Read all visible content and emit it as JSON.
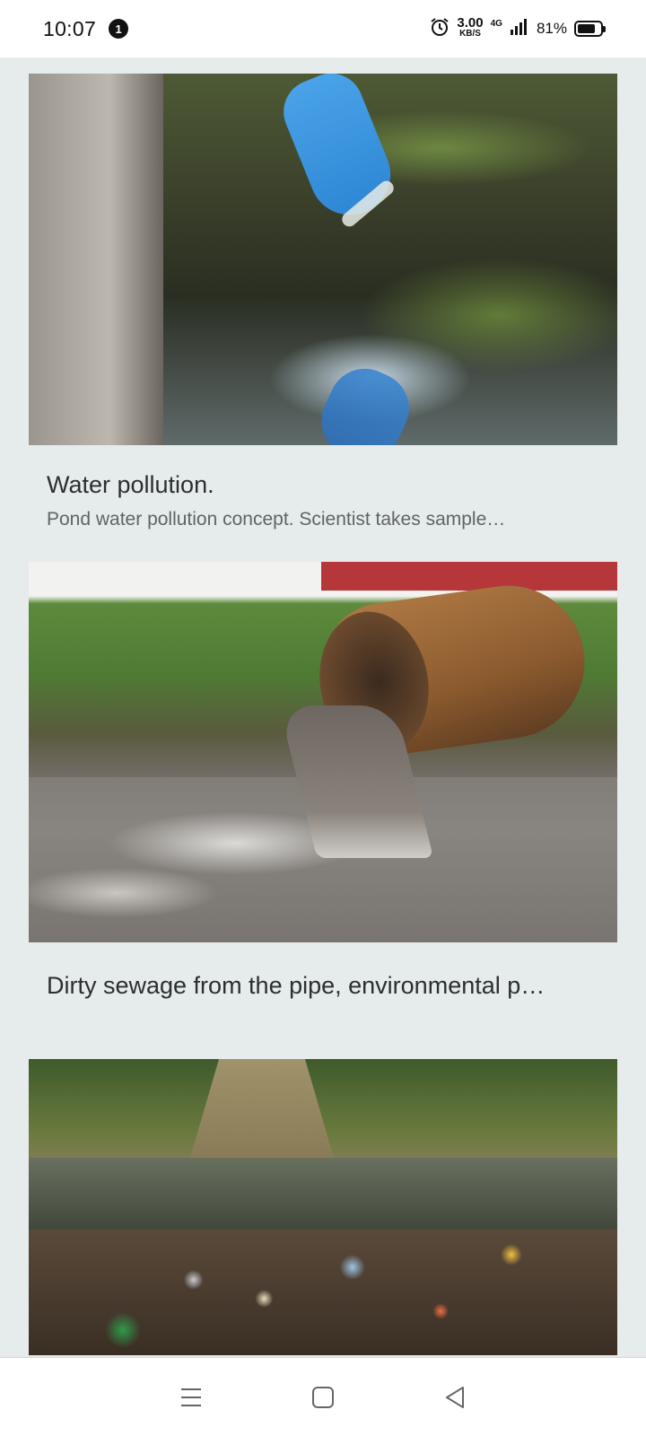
{
  "status_bar": {
    "time": "10:07",
    "notification_count": "1",
    "speed_value": "3.00",
    "speed_unit": "KB/S",
    "network_type": "4G",
    "battery_percent": "81%",
    "battery_level": 0.81
  },
  "cards": [
    {
      "title": "Water pollution.",
      "description": "Pond water pollution concept. Scientist takes sample…"
    },
    {
      "title": "Dirty sewage from the pipe, environmental p…"
    },
    {}
  ],
  "nav_bar": {
    "icons": [
      "menu-icon",
      "home-icon",
      "back-icon"
    ]
  }
}
